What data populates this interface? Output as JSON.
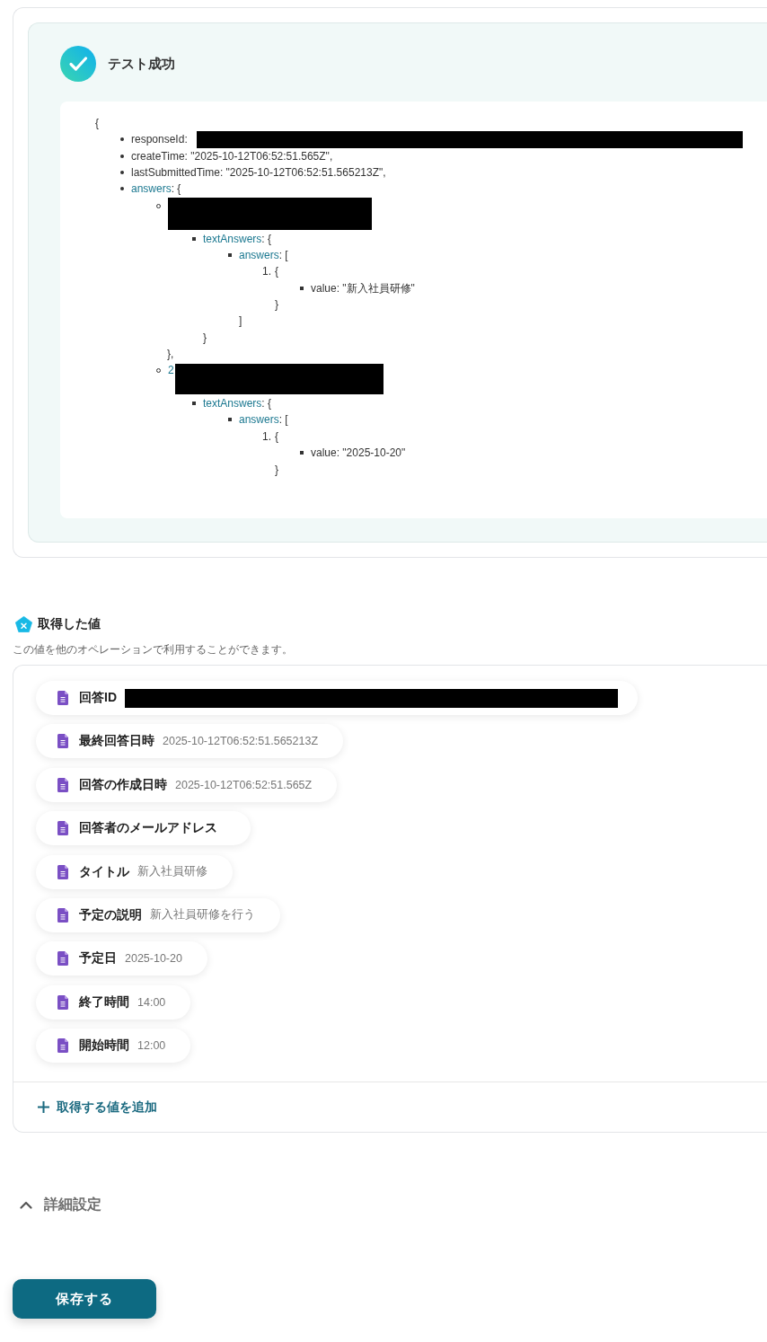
{
  "result": {
    "title": "テスト成功",
    "code": {
      "open": "{",
      "items": [
        {
          "kind": "field",
          "key": "responseId",
          "rest": ":",
          "redacted": true
        },
        {
          "kind": "field",
          "key": "createTime",
          "rest": ": \"2025-10-12T06:52:51.565Z\",",
          "redacted": false
        },
        {
          "kind": "field",
          "key": "lastSubmittedTime",
          "rest": ": \"2025-10-12T06:52:51.565213Z\",",
          "redacted": false
        },
        {
          "kind": "object",
          "key": "answers",
          "rest": ": {",
          "redacted": false,
          "children": [
            {
              "kind": "object",
              "redacted": true,
              "children": [
                {
                  "kind": "object",
                  "key": "textAnswers",
                  "rest": ": {",
                  "children": [
                    {
                      "kind": "array",
                      "key": "answers",
                      "rest": ": [",
                      "children": [
                        {
                          "kind": "entry",
                          "marker": "1.",
                          "rest": "{",
                          "children": [
                            {
                              "kind": "field",
                              "key": "value",
                              "rest": ": \"新入社員研修\""
                            }
                          ],
                          "close": "}"
                        }
                      ],
                      "close": "]"
                    }
                  ],
                  "close": "}"
                }
              ],
              "close": "},"
            },
            {
              "kind": "object",
              "key": "2",
              "redacted": true,
              "children": [
                {
                  "kind": "object",
                  "key": "textAnswers",
                  "rest": ": {",
                  "children": [
                    {
                      "kind": "array",
                      "key": "answers",
                      "rest": ": [",
                      "children": [
                        {
                          "kind": "entry",
                          "marker": "1.",
                          "rest": "{",
                          "children": [
                            {
                              "kind": "field",
                              "key": "value",
                              "rest": ": \"2025-10-20\""
                            }
                          ],
                          "close": "}"
                        }
                      ]
                    }
                  ]
                }
              ]
            }
          ]
        }
      ]
    }
  },
  "captured_values": {
    "title": "取得した値",
    "description": "この値を他のオペレーションで利用することができます。",
    "items": [
      {
        "label": "回答ID",
        "redacted": true
      },
      {
        "label": "最終回答日時",
        "value": "2025-10-12T06:52:51.565213Z",
        "redacted": false
      },
      {
        "label": "回答の作成日時",
        "value": "2025-10-12T06:52:51.565Z",
        "redacted": false
      },
      {
        "label": "回答者のメールアドレス",
        "redacted": false
      },
      {
        "label": "タイトル",
        "value": "新入社員研修",
        "redacted": false
      },
      {
        "label": "予定の説明",
        "value": "新入社員研修を行う",
        "redacted": false
      },
      {
        "label": "予定日",
        "value": "2025-10-20",
        "redacted": false
      },
      {
        "label": "終了時間",
        "value": "14:00",
        "redacted": false
      },
      {
        "label": "開始時間",
        "value": "12:00",
        "redacted": false
      }
    ],
    "add_button": "取得する値を追加"
  },
  "advanced_settings": {
    "label": "詳細設定",
    "expanded": true
  },
  "save_button": "保存する"
}
